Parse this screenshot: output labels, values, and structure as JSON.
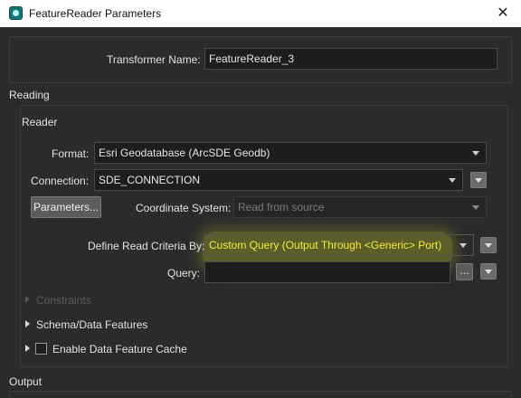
{
  "window": {
    "title": "FeatureReader Parameters",
    "close_glyph": "✕"
  },
  "transformer": {
    "label": "Transformer Name:",
    "value": "FeatureReader_3"
  },
  "reading": {
    "section_label": "Reading"
  },
  "reader": {
    "group_label": "Reader",
    "format_label": "Format:",
    "format_value": "Esri Geodatabase (ArcSDE Geodb)",
    "connection_label": "Connection:",
    "connection_value": "SDE_CONNECTION",
    "parameters_button": "Parameters...",
    "coord_label": "Coordinate System:",
    "coord_placeholder": "Read from source",
    "criteria_label": "Define Read Criteria By:",
    "criteria_value": "Custom Query (Output Through <Generic> Port)",
    "query_label": "Query:",
    "query_value": "",
    "ellipsis_button": "..."
  },
  "expanders": {
    "constraints": "Constraints",
    "schema": "Schema/Data Features",
    "cache": "Enable Data Feature Cache"
  },
  "output": {
    "section_label": "Output"
  },
  "colors": {
    "highlight": "#d2d228",
    "highlight_text": "#f2ec3a"
  }
}
